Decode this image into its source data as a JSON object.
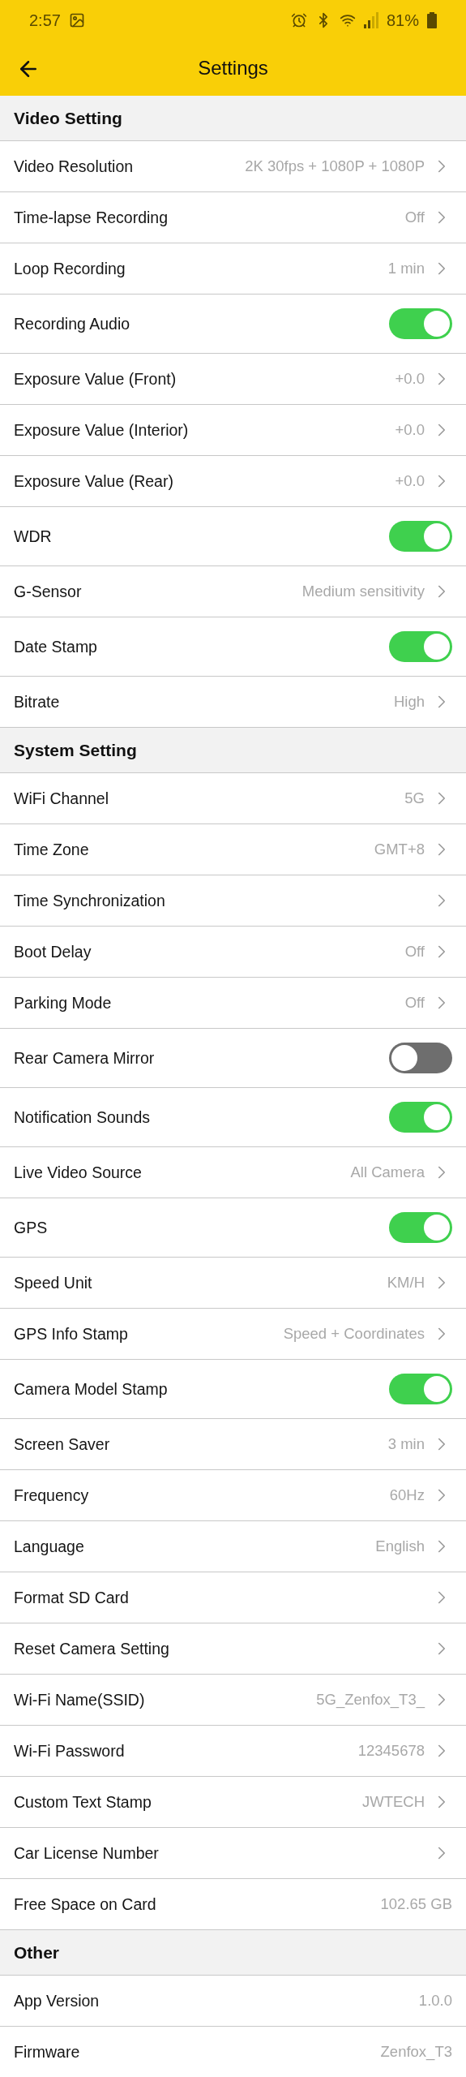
{
  "status_bar": {
    "time": "2:57",
    "battery": "81%"
  },
  "header": {
    "title": "Settings"
  },
  "sections": [
    {
      "title": "Video Setting",
      "rows": [
        {
          "kind": "chevron",
          "label": "Video Resolution",
          "value": "2K 30fps + 1080P + 1080P"
        },
        {
          "kind": "chevron",
          "label": "Time-lapse Recording",
          "value": "Off"
        },
        {
          "kind": "chevron",
          "label": "Loop Recording",
          "value": "1 min"
        },
        {
          "kind": "toggle",
          "label": "Recording Audio",
          "on": true
        },
        {
          "kind": "chevron",
          "label": "Exposure Value (Front)",
          "value": "+0.0"
        },
        {
          "kind": "chevron",
          "label": "Exposure Value (Interior)",
          "value": "+0.0"
        },
        {
          "kind": "chevron",
          "label": "Exposure Value (Rear)",
          "value": "+0.0"
        },
        {
          "kind": "toggle",
          "label": "WDR",
          "on": true
        },
        {
          "kind": "chevron",
          "label": "G-Sensor",
          "value": "Medium sensitivity"
        },
        {
          "kind": "toggle",
          "label": "Date Stamp",
          "on": true
        },
        {
          "kind": "chevron",
          "label": "Bitrate",
          "value": "High"
        }
      ]
    },
    {
      "title": "System Setting",
      "rows": [
        {
          "kind": "chevron",
          "label": "WiFi Channel",
          "value": "5G"
        },
        {
          "kind": "chevron",
          "label": "Time Zone",
          "value": "GMT+8"
        },
        {
          "kind": "chevron",
          "label": "Time Synchronization"
        },
        {
          "kind": "chevron",
          "label": "Boot Delay",
          "value": "Off"
        },
        {
          "kind": "chevron",
          "label": "Parking Mode",
          "value": "Off"
        },
        {
          "kind": "toggle",
          "label": "Rear Camera Mirror",
          "on": false
        },
        {
          "kind": "toggle",
          "label": "Notification Sounds",
          "on": true
        },
        {
          "kind": "chevron",
          "label": "Live Video Source",
          "value": "All Camera"
        },
        {
          "kind": "toggle",
          "label": "GPS",
          "on": true
        },
        {
          "kind": "chevron",
          "label": "Speed Unit",
          "value": "KM/H"
        },
        {
          "kind": "chevron",
          "label": "GPS Info Stamp",
          "value": "Speed + Coordinates"
        },
        {
          "kind": "toggle",
          "label": "Camera Model Stamp",
          "on": true
        },
        {
          "kind": "chevron",
          "label": "Screen Saver",
          "value": "3 min"
        },
        {
          "kind": "chevron",
          "label": "Frequency",
          "value": "60Hz"
        },
        {
          "kind": "chevron",
          "label": "Language",
          "value": "English"
        },
        {
          "kind": "chevron",
          "label": "Format SD Card"
        },
        {
          "kind": "chevron",
          "label": "Reset Camera Setting"
        },
        {
          "kind": "chevron",
          "label": "Wi-Fi Name(SSID)",
          "value": "5G_Zenfox_T3_"
        },
        {
          "kind": "chevron",
          "label": "Wi-Fi Password",
          "value": "12345678"
        },
        {
          "kind": "chevron",
          "label": "Custom Text Stamp",
          "value": "JWTECH"
        },
        {
          "kind": "chevron",
          "label": "Car License Number"
        },
        {
          "kind": "plain",
          "label": "Free Space on Card",
          "value": "102.65 GB"
        }
      ]
    },
    {
      "title": "Other",
      "rows": [
        {
          "kind": "plain",
          "label": "App Version",
          "value": "1.0.0"
        },
        {
          "kind": "plain",
          "label": "Firmware",
          "value": "Zenfox_T3"
        }
      ]
    }
  ]
}
